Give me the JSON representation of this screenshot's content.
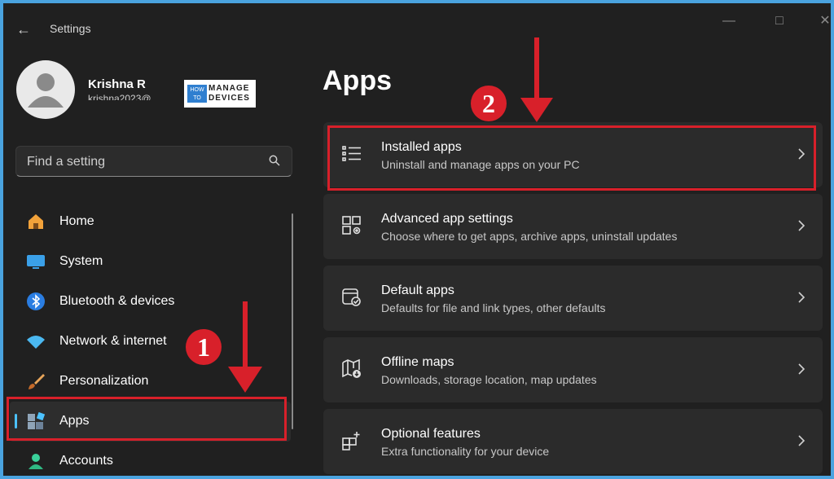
{
  "window": {
    "title": "Settings"
  },
  "user": {
    "name": "Krishna R",
    "email": "krishna2023@"
  },
  "logo": {
    "how": "HOW TO",
    "text_line1": "MANAGE",
    "text_line2": "DEVICES"
  },
  "search": {
    "placeholder": "Find a setting"
  },
  "nav": {
    "items": [
      {
        "label": "Home",
        "icon": "home-icon"
      },
      {
        "label": "System",
        "icon": "monitor-icon"
      },
      {
        "label": "Bluetooth & devices",
        "icon": "bluetooth-icon"
      },
      {
        "label": "Network & internet",
        "icon": "wifi-icon"
      },
      {
        "label": "Personalization",
        "icon": "brush-icon"
      },
      {
        "label": "Apps",
        "icon": "apps-icon",
        "selected": true
      },
      {
        "label": "Accounts",
        "icon": "person-icon"
      }
    ]
  },
  "main": {
    "title": "Apps",
    "cards": [
      {
        "title": "Installed apps",
        "subtitle": "Uninstall and manage apps on your PC",
        "icon": "list-icon"
      },
      {
        "title": "Advanced app settings",
        "subtitle": "Choose where to get apps, archive apps, uninstall updates",
        "icon": "app-settings-icon"
      },
      {
        "title": "Default apps",
        "subtitle": "Defaults for file and link types, other defaults",
        "icon": "default-apps-icon"
      },
      {
        "title": "Offline maps",
        "subtitle": "Downloads, storage location, map updates",
        "icon": "map-icon"
      },
      {
        "title": "Optional features",
        "subtitle": "Extra functionality for your device",
        "icon": "add-feature-icon"
      }
    ]
  },
  "annotations": {
    "step1": "1",
    "step2": "2",
    "color": "#d8202a"
  },
  "colors": {
    "accent": "#4cc2ff",
    "background": "#202020",
    "card": "#2b2b2b",
    "frame": "#4aa3df"
  }
}
